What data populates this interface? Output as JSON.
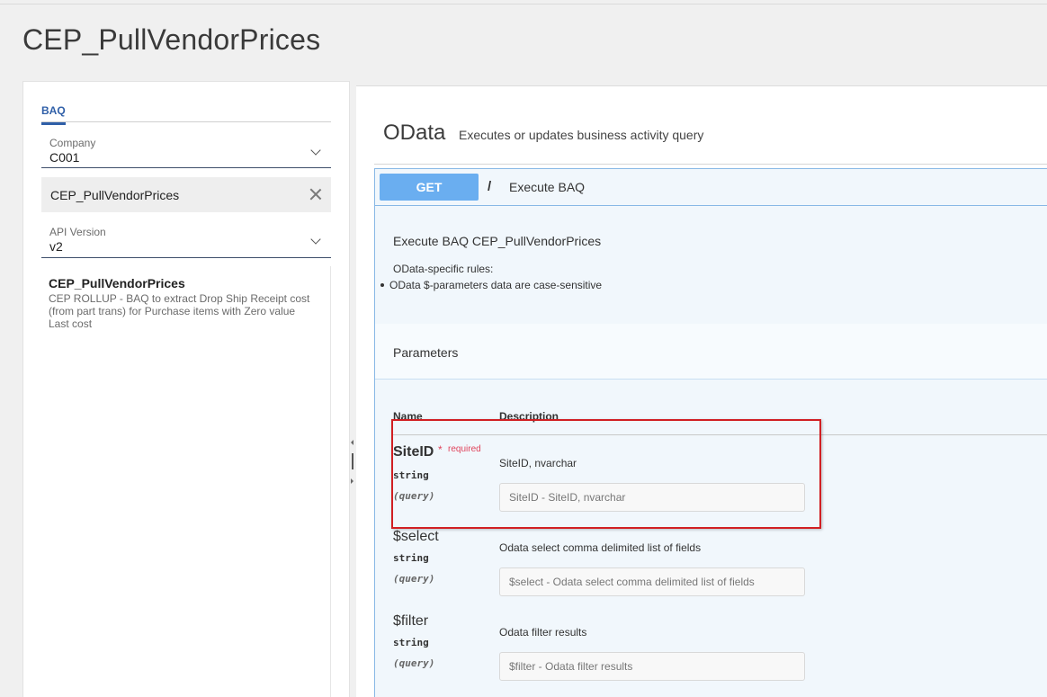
{
  "page": {
    "title": "CEP_PullVendorPrices"
  },
  "left": {
    "tab_label": "BAQ",
    "company": {
      "label": "Company",
      "value": "C001"
    },
    "baq_value": "CEP_PullVendorPrices",
    "api_version": {
      "label": "API Version",
      "value": "v2"
    },
    "list": {
      "title": "CEP_PullVendorPrices",
      "description": "CEP ROLLUP - BAQ to extract Drop Ship Receipt cost (from part trans) for Purchase items with Zero value Last cost"
    }
  },
  "right": {
    "title": "OData",
    "subtitle": "Executes or updates business activity query",
    "operation": {
      "method": "GET",
      "path": "/",
      "summary": "Execute BAQ",
      "description_title": "Execute BAQ CEP_PullVendorPrices",
      "rules_label": "OData-specific rules:",
      "rules": [
        "OData $-parameters data are case-sensitive"
      ]
    },
    "parameters": {
      "title": "Parameters",
      "col_name": "Name",
      "col_description": "Description",
      "items": [
        {
          "name": "SiteID",
          "required_star": "*",
          "required": "required",
          "type": "string",
          "in": "(query)",
          "description": "SiteID, nvarchar",
          "placeholder": "SiteID - SiteID, nvarchar"
        },
        {
          "name": "$select",
          "type": "string",
          "in": "(query)",
          "description": "Odata select comma delimited list of fields",
          "placeholder": "$select - Odata select comma delimited list of fields"
        },
        {
          "name": "$filter",
          "type": "string",
          "in": "(query)",
          "description": "Odata filter results",
          "placeholder": "$filter - Odata filter results"
        }
      ]
    }
  },
  "colors": {
    "accent": "#2f5fa8",
    "get_button": "#6aaef0",
    "required": "#e0445c",
    "highlight": "#d11f23"
  }
}
